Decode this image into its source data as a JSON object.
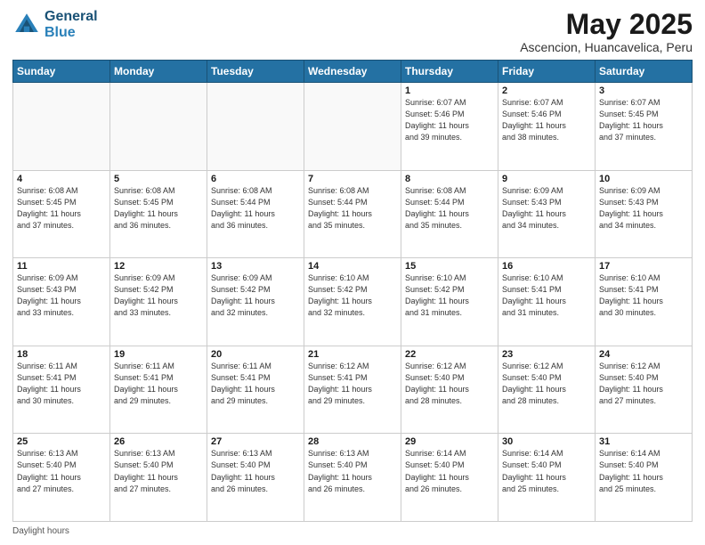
{
  "header": {
    "logo_line1": "General",
    "logo_line2": "Blue",
    "month_title": "May 2025",
    "subtitle": "Ascencion, Huancavelica, Peru"
  },
  "days_of_week": [
    "Sunday",
    "Monday",
    "Tuesday",
    "Wednesday",
    "Thursday",
    "Friday",
    "Saturday"
  ],
  "footer": {
    "daylight_note": "Daylight hours"
  },
  "weeks": [
    [
      {
        "day": "",
        "info": ""
      },
      {
        "day": "",
        "info": ""
      },
      {
        "day": "",
        "info": ""
      },
      {
        "day": "",
        "info": ""
      },
      {
        "day": "1",
        "info": "Sunrise: 6:07 AM\nSunset: 5:46 PM\nDaylight: 11 hours\nand 39 minutes."
      },
      {
        "day": "2",
        "info": "Sunrise: 6:07 AM\nSunset: 5:46 PM\nDaylight: 11 hours\nand 38 minutes."
      },
      {
        "day": "3",
        "info": "Sunrise: 6:07 AM\nSunset: 5:45 PM\nDaylight: 11 hours\nand 37 minutes."
      }
    ],
    [
      {
        "day": "4",
        "info": "Sunrise: 6:08 AM\nSunset: 5:45 PM\nDaylight: 11 hours\nand 37 minutes."
      },
      {
        "day": "5",
        "info": "Sunrise: 6:08 AM\nSunset: 5:45 PM\nDaylight: 11 hours\nand 36 minutes."
      },
      {
        "day": "6",
        "info": "Sunrise: 6:08 AM\nSunset: 5:44 PM\nDaylight: 11 hours\nand 36 minutes."
      },
      {
        "day": "7",
        "info": "Sunrise: 6:08 AM\nSunset: 5:44 PM\nDaylight: 11 hours\nand 35 minutes."
      },
      {
        "day": "8",
        "info": "Sunrise: 6:08 AM\nSunset: 5:44 PM\nDaylight: 11 hours\nand 35 minutes."
      },
      {
        "day": "9",
        "info": "Sunrise: 6:09 AM\nSunset: 5:43 PM\nDaylight: 11 hours\nand 34 minutes."
      },
      {
        "day": "10",
        "info": "Sunrise: 6:09 AM\nSunset: 5:43 PM\nDaylight: 11 hours\nand 34 minutes."
      }
    ],
    [
      {
        "day": "11",
        "info": "Sunrise: 6:09 AM\nSunset: 5:43 PM\nDaylight: 11 hours\nand 33 minutes."
      },
      {
        "day": "12",
        "info": "Sunrise: 6:09 AM\nSunset: 5:42 PM\nDaylight: 11 hours\nand 33 minutes."
      },
      {
        "day": "13",
        "info": "Sunrise: 6:09 AM\nSunset: 5:42 PM\nDaylight: 11 hours\nand 32 minutes."
      },
      {
        "day": "14",
        "info": "Sunrise: 6:10 AM\nSunset: 5:42 PM\nDaylight: 11 hours\nand 32 minutes."
      },
      {
        "day": "15",
        "info": "Sunrise: 6:10 AM\nSunset: 5:42 PM\nDaylight: 11 hours\nand 31 minutes."
      },
      {
        "day": "16",
        "info": "Sunrise: 6:10 AM\nSunset: 5:41 PM\nDaylight: 11 hours\nand 31 minutes."
      },
      {
        "day": "17",
        "info": "Sunrise: 6:10 AM\nSunset: 5:41 PM\nDaylight: 11 hours\nand 30 minutes."
      }
    ],
    [
      {
        "day": "18",
        "info": "Sunrise: 6:11 AM\nSunset: 5:41 PM\nDaylight: 11 hours\nand 30 minutes."
      },
      {
        "day": "19",
        "info": "Sunrise: 6:11 AM\nSunset: 5:41 PM\nDaylight: 11 hours\nand 29 minutes."
      },
      {
        "day": "20",
        "info": "Sunrise: 6:11 AM\nSunset: 5:41 PM\nDaylight: 11 hours\nand 29 minutes."
      },
      {
        "day": "21",
        "info": "Sunrise: 6:12 AM\nSunset: 5:41 PM\nDaylight: 11 hours\nand 29 minutes."
      },
      {
        "day": "22",
        "info": "Sunrise: 6:12 AM\nSunset: 5:40 PM\nDaylight: 11 hours\nand 28 minutes."
      },
      {
        "day": "23",
        "info": "Sunrise: 6:12 AM\nSunset: 5:40 PM\nDaylight: 11 hours\nand 28 minutes."
      },
      {
        "day": "24",
        "info": "Sunrise: 6:12 AM\nSunset: 5:40 PM\nDaylight: 11 hours\nand 27 minutes."
      }
    ],
    [
      {
        "day": "25",
        "info": "Sunrise: 6:13 AM\nSunset: 5:40 PM\nDaylight: 11 hours\nand 27 minutes."
      },
      {
        "day": "26",
        "info": "Sunrise: 6:13 AM\nSunset: 5:40 PM\nDaylight: 11 hours\nand 27 minutes."
      },
      {
        "day": "27",
        "info": "Sunrise: 6:13 AM\nSunset: 5:40 PM\nDaylight: 11 hours\nand 26 minutes."
      },
      {
        "day": "28",
        "info": "Sunrise: 6:13 AM\nSunset: 5:40 PM\nDaylight: 11 hours\nand 26 minutes."
      },
      {
        "day": "29",
        "info": "Sunrise: 6:14 AM\nSunset: 5:40 PM\nDaylight: 11 hours\nand 26 minutes."
      },
      {
        "day": "30",
        "info": "Sunrise: 6:14 AM\nSunset: 5:40 PM\nDaylight: 11 hours\nand 25 minutes."
      },
      {
        "day": "31",
        "info": "Sunrise: 6:14 AM\nSunset: 5:40 PM\nDaylight: 11 hours\nand 25 minutes."
      }
    ]
  ]
}
